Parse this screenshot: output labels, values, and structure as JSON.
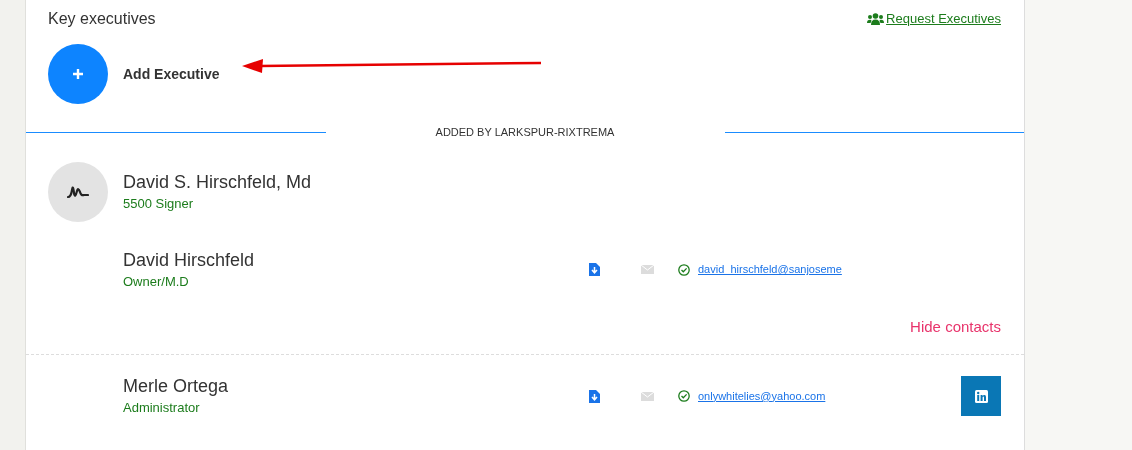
{
  "section": {
    "title": "Key executives",
    "request_link": "Request Executives"
  },
  "add_button": {
    "label": "Add Executive"
  },
  "annotation": {
    "kind": "arrow"
  },
  "divider": {
    "label": "ADDED BY LARKSPUR-RIXTREMA"
  },
  "executive": {
    "name": "David S. Hirschfeld, Md",
    "role": "5500 Signer"
  },
  "contacts": [
    {
      "name": "David Hirschfeld",
      "title": "Owner/M.D",
      "email": "david_hirschfeld@sanjoseme",
      "linkedin": false
    },
    {
      "name": "Merle Ortega",
      "title": "Administrator",
      "email": "onlywhitelies@yahoo.com",
      "linkedin": true
    }
  ],
  "hide_contacts": "Hide contacts"
}
